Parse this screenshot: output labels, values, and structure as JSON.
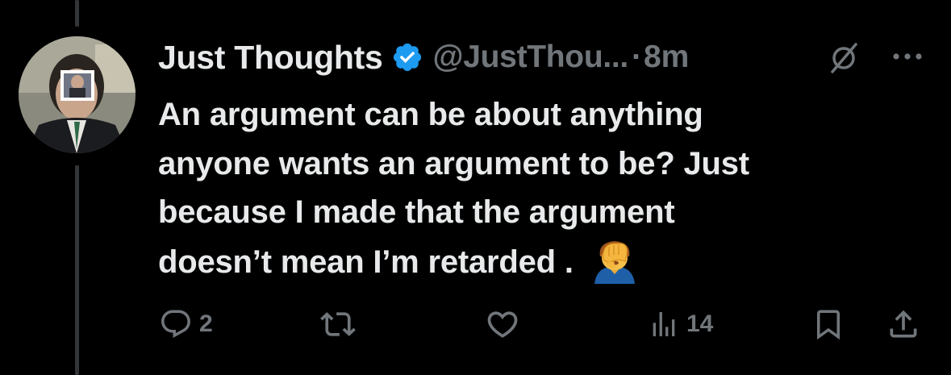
{
  "tweet": {
    "display_name": "Just Thoughts",
    "handle": "@JustThou...",
    "separator": "·",
    "time": "8m",
    "text_lines": [
      "An argument can be about anything",
      "anyone wants an argument to be? Just",
      "because I made that the argument",
      "doesn’t mean I’m retarded ."
    ],
    "emoji": "face-palm-emoji"
  },
  "actions": {
    "replies_count": "2",
    "views_count": "14"
  },
  "icons": {
    "verified": "verified-badge-icon",
    "grok": "grok-icon",
    "more": "more-icon",
    "reply": "reply-icon",
    "retweet": "retweet-icon",
    "like": "like-icon",
    "views": "views-icon",
    "bookmark": "bookmark-icon",
    "share": "share-icon"
  },
  "colors": {
    "background": "#000000",
    "text": "#e7e9ea",
    "secondary": "#71767b",
    "verified": "#1d9bf0",
    "thread_line": "#333639"
  }
}
